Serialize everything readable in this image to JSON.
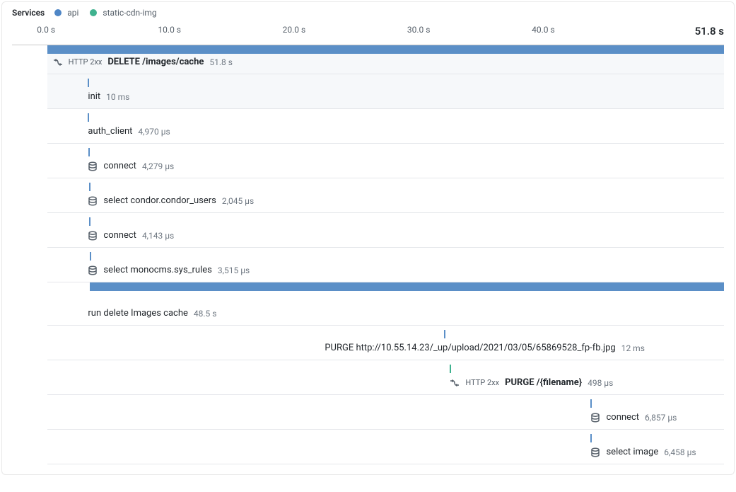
{
  "legend": {
    "title": "Services",
    "items": [
      {
        "name": "api",
        "color": "#4f86c6"
      },
      {
        "name": "static-cdn-img",
        "color": "#3fb28f"
      }
    ]
  },
  "axis": {
    "ticks": [
      "0.0 s",
      "10.0 s",
      "20.0 s",
      "30.0 s",
      "40.0 s"
    ],
    "end": "51.8 s"
  },
  "spans": [
    {
      "kind": "bar-full"
    },
    {
      "kind": "root",
      "icon": "flow",
      "status": "HTTP 2xx",
      "op": "DELETE /images/cache",
      "dur": "51.8 s",
      "leftPct": 0.8,
      "bold": true
    },
    {
      "kind": "span",
      "icon": "",
      "op": "init",
      "dur": "10 ms",
      "barLeft": 6,
      "labelLeft": 6,
      "color": "blue"
    },
    {
      "kind": "span",
      "icon": "",
      "op": "auth_client",
      "dur": "4,970 µs",
      "barLeft": 6,
      "labelLeft": 6,
      "color": "blue"
    },
    {
      "kind": "span",
      "icon": "db",
      "op": "connect",
      "dur": "4,279 µs",
      "barLeft": 6.1,
      "labelLeft": 6,
      "color": "blue"
    },
    {
      "kind": "span",
      "icon": "db",
      "op": "select condor.condor_users",
      "dur": "2,045 µs",
      "barLeft": 6.2,
      "labelLeft": 6,
      "color": "blue"
    },
    {
      "kind": "span",
      "icon": "db",
      "op": "connect",
      "dur": "4,143 µs",
      "barLeft": 6.2,
      "labelLeft": 6,
      "color": "blue"
    },
    {
      "kind": "span",
      "icon": "db",
      "op": "select monocms.sys_rules",
      "dur": "3,515 µs",
      "barLeft": 6.3,
      "labelLeft": 6,
      "color": "blue"
    },
    {
      "kind": "bar-indent",
      "leftPct": 6.3
    },
    {
      "kind": "span",
      "icon": "",
      "op": "run delete Images cache",
      "dur": "48.5 s",
      "barLeft": -100,
      "labelLeft": 6,
      "color": "blue",
      "labelOnly": true
    },
    {
      "kind": "span",
      "icon": "",
      "op": "PURGE http://10.55.14.23/_up/upload/2021/03/05/65869528_fp-fb.jpg",
      "dur": "12 ms",
      "barLeft": 58.6,
      "labelLeft": 41,
      "color": "blue"
    },
    {
      "kind": "root2",
      "icon": "flow",
      "status": "HTTP 2xx",
      "op": "PURGE /{filename}",
      "dur": "498 µs",
      "barLeft": 59.5,
      "labelLeft": 59.5,
      "color": "green",
      "bold": true
    },
    {
      "kind": "span",
      "icon": "db",
      "op": "connect",
      "dur": "6,857 µs",
      "barLeft": 80.3,
      "labelLeft": 80.3,
      "color": "blue"
    },
    {
      "kind": "span",
      "icon": "db",
      "op": "select image",
      "dur": "6,458 µs",
      "barLeft": 80.3,
      "labelLeft": 80.3,
      "color": "blue"
    }
  ]
}
